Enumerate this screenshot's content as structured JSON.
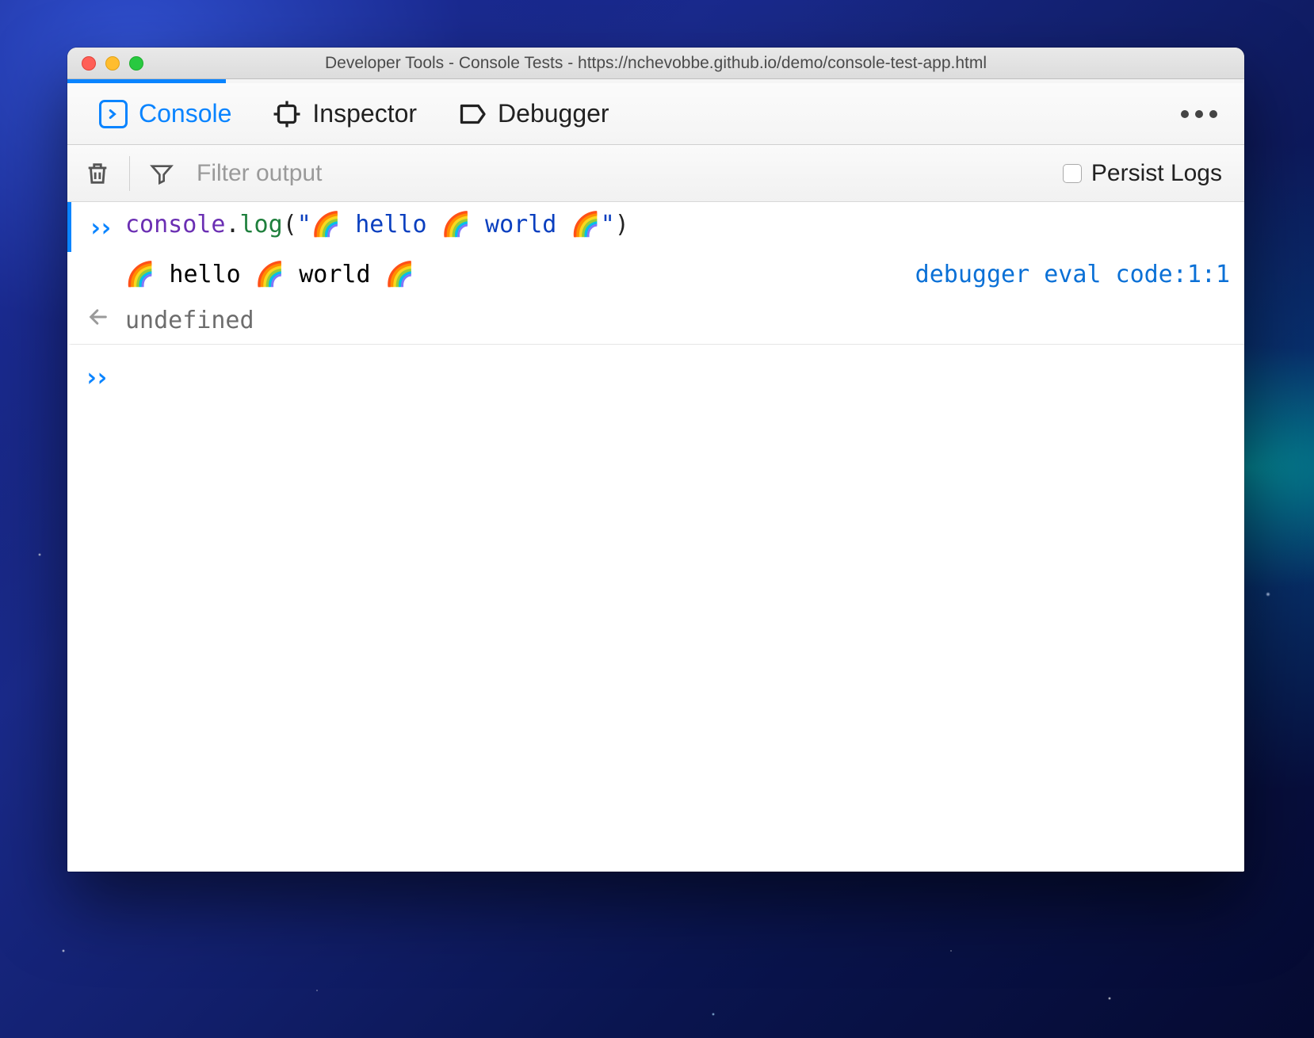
{
  "window": {
    "title": "Developer Tools - Console Tests - https://nchevobbe.github.io/demo/console-test-app.html"
  },
  "tabs": {
    "items": [
      {
        "label": "Console",
        "icon": "console-icon",
        "active": true
      },
      {
        "label": "Inspector",
        "icon": "inspector-icon",
        "active": false
      },
      {
        "label": "Debugger",
        "icon": "debugger-icon",
        "active": false
      }
    ]
  },
  "toolbar": {
    "filter_placeholder": "Filter output",
    "persist_label": "Persist Logs",
    "persist_checked": false
  },
  "console": {
    "input_code": {
      "obj": "console",
      "dot": ".",
      "method": "log",
      "open": "(",
      "str_open": "\"",
      "str_body": "🌈 hello 🌈 world 🌈",
      "str_close": "\"",
      "close": ")"
    },
    "log_output": "🌈 hello 🌈 world 🌈",
    "log_location": {
      "source": "debugger eval code",
      "line": "1",
      "col": "1"
    },
    "result": "undefined"
  },
  "colors": {
    "accent": "#0a84ff"
  }
}
